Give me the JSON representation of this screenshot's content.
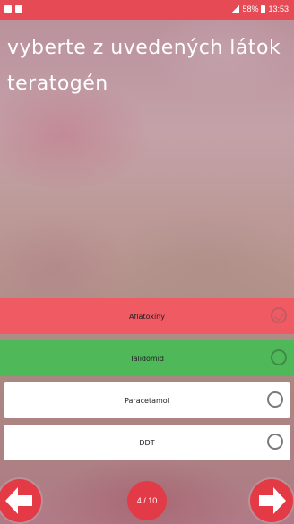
{
  "status_bar": {
    "battery_text": "58%",
    "time": "13:53"
  },
  "question": {
    "text": "vyberte z uvedených látok teratogén"
  },
  "options": [
    {
      "label": "Aflatoxíny",
      "state": "wrong"
    },
    {
      "label": "Talidomid",
      "state": "correct"
    },
    {
      "label": "Paracetamol",
      "state": "unselected"
    },
    {
      "label": "DDT",
      "state": "unselected"
    }
  ],
  "navigation": {
    "progress": "4 / 10",
    "prev_icon": "arrow-left-icon",
    "next_icon": "arrow-right-icon"
  },
  "colors": {
    "accent_red": "#e64a55",
    "wrong": "#ef5a63",
    "correct": "#4fb859",
    "neutral": "#ffffff"
  }
}
